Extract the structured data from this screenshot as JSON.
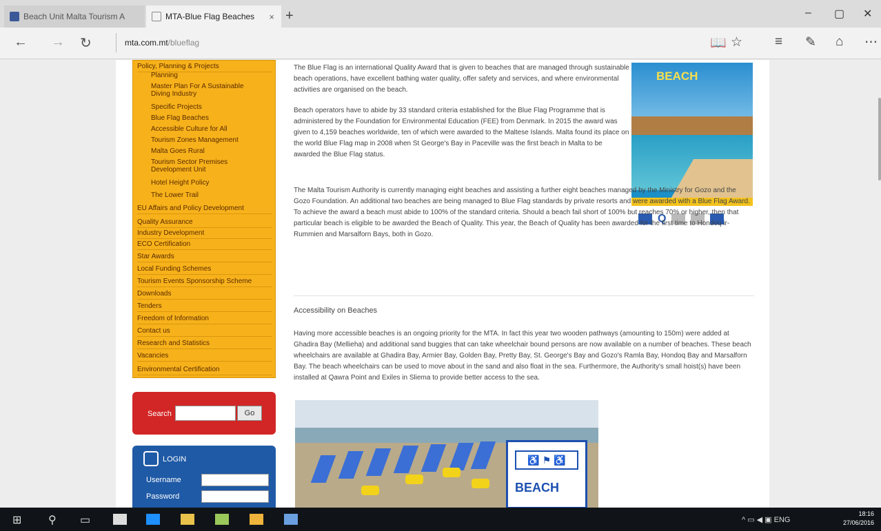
{
  "browser": {
    "tabs": [
      {
        "label": "Beach Unit Malta Tourism A"
      },
      {
        "label": "MTA-Blue Flag Beaches",
        "close": "×"
      }
    ],
    "new_tab": "+",
    "window_controls": {
      "minimize": "–",
      "maximize": "▢",
      "close": "✕"
    },
    "nav": {
      "back": "←",
      "forward": "→",
      "refresh": "↻"
    },
    "address": {
      "domain": "mta.com.mt",
      "path": "/blueflag"
    },
    "toolbar": {
      "reading_view": "📖",
      "favorite": "☆",
      "hub": "≡",
      "notes": "✎",
      "share": "⌂",
      "more": "⋯"
    }
  },
  "menu": {
    "items": [
      {
        "label": "Policy, Planning & Projects",
        "level": "top"
      },
      {
        "label": "Planning",
        "level": "sub"
      },
      {
        "label": "Master Plan For A Sustainable Diving Industry",
        "level": "sub"
      },
      {
        "label": "Specific Projects",
        "level": "sub"
      },
      {
        "label": "Blue Flag Beaches",
        "level": "sub"
      },
      {
        "label": "Accessible Culture for All",
        "level": "sub"
      },
      {
        "label": "Tourism Zones Management",
        "level": "sub"
      },
      {
        "label": "Malta Goes Rural",
        "level": "sub"
      },
      {
        "label": "Tourism Sector Premises Development Unit",
        "level": "sub"
      },
      {
        "label": "Hotel Height Policy",
        "level": "sub"
      },
      {
        "label": "The Lower Trail",
        "level": "sub"
      },
      {
        "label": "EU Affairs and Policy Development",
        "level": "top"
      },
      {
        "label": "Quality Assurance",
        "level": "top"
      },
      {
        "label": "Industry Development",
        "level": "top"
      },
      {
        "label": "ECO Certification",
        "level": "top"
      },
      {
        "label": "Star Awards",
        "level": "top"
      },
      {
        "label": "Local Funding Schemes",
        "level": "top"
      },
      {
        "label": "Tourism Events Sponsorship Scheme",
        "level": "top"
      },
      {
        "label": "Downloads",
        "level": "top"
      },
      {
        "label": "Tenders",
        "level": "top"
      },
      {
        "label": "Freedom of Information",
        "level": "top"
      },
      {
        "label": "Contact us",
        "level": "top"
      },
      {
        "label": "Research and Statistics",
        "level": "top"
      },
      {
        "label": "Vacancies",
        "level": "top"
      },
      {
        "label": "Environmental Certification",
        "level": "top"
      }
    ]
  },
  "search": {
    "label": "Search",
    "button": "Go"
  },
  "login": {
    "title": "LOGIN",
    "username_label": "Username",
    "password_label": "Password"
  },
  "content": {
    "p1": "The Blue Flag is an international Quality Award that is given to beaches that are managed through sustainable beach operations, have excellent bathing water quality, offer safety and services, and where environmental activities are organised on the beach.",
    "p2": "Beach operators have to abide by 33 standard criteria established for the Blue Flag Programme that is administered by the Foundation for Environmental Education (FEE) from Denmark. In 2015 the award was given to 4,159 beaches worldwide, ten of which were awarded to the Maltese Islands. Malta found its place on the world Blue Flag map in 2008 when St George's Bay in Paceville was the first beach in Malta to be awarded the Blue Flag status.",
    "p3": "The Malta Tourism Authority is currently managing eight beaches and assisting a further eight beaches managed by the Ministry for Gozo and the Gozo Foundation. An additional two beaches are being managed to Blue Flag standards by private resorts and were awarded with a Blue Flag Award. To achieve the award a beach must abide to 100% of the standard criteria. Should a beach fail short of 100% but reaches 70% or higher, then that particular beach is eligible to be awarded the Beach of Quality. This year, the Beach of Quality has been awarded for the first time to Hondoq ir-Rummien and Marsalforn Bays, both in Gozo.",
    "heading": "Accessibility on Beaches",
    "p4": "Having more accessible beaches is an ongoing priority for the MTA. In fact this year two wooden pathways (amounting to 150m) were added at Ghadira Bay (Mellieha) and additional sand buggies that can take wheelchair bound persons are now available on a number of beaches. These beach wheelchairs are available at Ghadira Bay, Armier Bay, Golden Bay, Pretty Bay, St. George's Bay and Gozo's Ramla Bay, Hondoq Bay and Marsalforn Bay. The beach wheelchairs can be used to move about in the sand and also float in the sea. Furthermore, the Authority's small hoist(s) have been installed at Qawra Point and Exiles in Sliema to provide better access to the sea."
  },
  "poster": {
    "title": "BEACH"
  },
  "beach_sign": {
    "icons": "♿ ⚑ ♿",
    "text": "BEACH"
  },
  "taskbar": {
    "start": "⊞",
    "search": "⚲",
    "task_view": "▭",
    "tray": "^ ▭ ◀ ▣ ENG",
    "time": "18:16",
    "date": "27/06/2016"
  },
  "colors": {
    "menu_bg": "#f7b21b",
    "search_bg": "#d22626",
    "login_bg": "#1f5aa6"
  }
}
